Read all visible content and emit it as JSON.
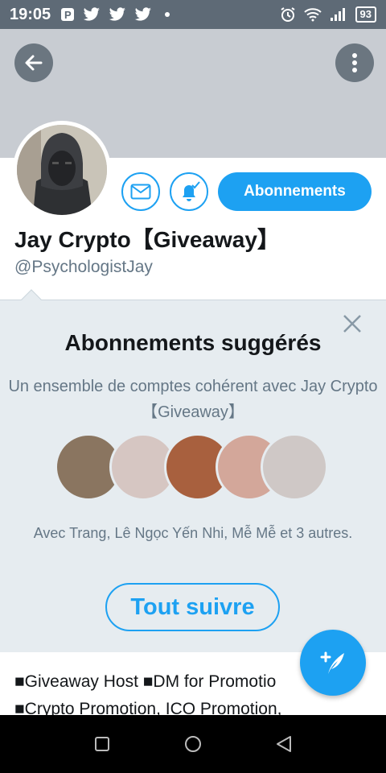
{
  "status_bar": {
    "time": "19:05",
    "battery": "93",
    "left_icons": [
      "p-icon",
      "twitter-icon",
      "twitter-icon",
      "twitter-icon"
    ],
    "right_icons": [
      "alarm-icon",
      "wifi-icon",
      "signal-icon",
      "battery-icon"
    ]
  },
  "profile": {
    "display_name": "Jay Crypto【Giveaway】",
    "handle": "@PsychologistJay",
    "follow_label": "Abonnements",
    "bio_lines": [
      "■Giveaway Host ■DM for Promotio",
      "■Crypto Promotion, ICO Promotion,"
    ]
  },
  "suggestions": {
    "title": "Abonnements suggérés",
    "subtitle": "Un ensemble de comptes cohérent avec Jay Crypto【Giveaway】",
    "people_text": "Avec Trang, Lê Ngọc Yến Nhi, Mễ Mễ et 3 autres.",
    "follow_all_label": "Tout suivre"
  },
  "colors": {
    "accent": "#1da1f2",
    "status_bar": "#5e6a76",
    "panel": "#e6ecf0"
  }
}
